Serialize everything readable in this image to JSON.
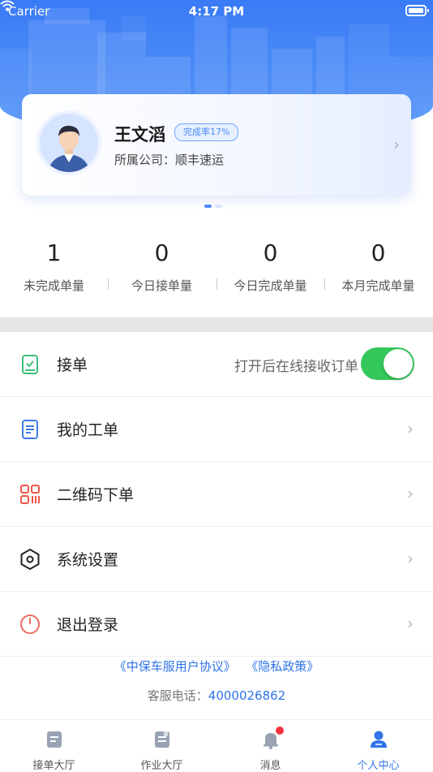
{
  "status_bar": {
    "carrier": "Carrier",
    "time": "4:17 PM"
  },
  "profile": {
    "name": "王文滔",
    "completion_badge": "完成率17%",
    "company": "所属公司：顺丰速运"
  },
  "carousel": {
    "total": 2,
    "active_index": 0
  },
  "stats": [
    {
      "value": "1",
      "label": "未完成单量"
    },
    {
      "value": "0",
      "label": "今日接单量"
    },
    {
      "value": "0",
      "label": "今日完成单量"
    },
    {
      "value": "0",
      "label": "本月完成单量"
    }
  ],
  "menu": {
    "accept_orders": {
      "label": "接单",
      "hint": "打开后在线接收订单",
      "toggle_on": true
    },
    "my_orders": {
      "label": "我的工单"
    },
    "qr_order": {
      "label": "二维码下单"
    },
    "settings": {
      "label": "系统设置"
    },
    "logout": {
      "label": "退出登录"
    }
  },
  "footer": {
    "user_agreement": "《中保车服用户协议》",
    "privacy_policy": "《隐私政策》",
    "hotline_label": "客服电话：",
    "hotline_number": "4000026862"
  },
  "tabs": [
    {
      "label": "接单大厅",
      "icon": "order-hall-icon",
      "active": false
    },
    {
      "label": "作业大厅",
      "icon": "work-hall-icon",
      "active": false
    },
    {
      "label": "消息",
      "icon": "bell-icon",
      "active": false,
      "has_badge": true
    },
    {
      "label": "个人中心",
      "icon": "person-icon",
      "active": true
    }
  ],
  "colors": {
    "primary": "#2f74e8",
    "hero_gradient_top": "#3a7bf6",
    "toggle_on": "#34c759",
    "badge_red": "#f5333f"
  }
}
